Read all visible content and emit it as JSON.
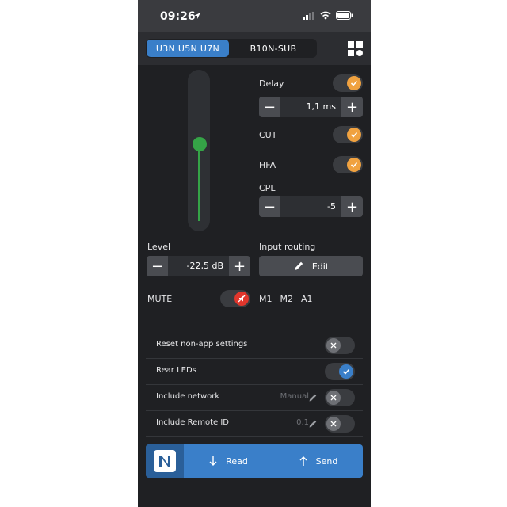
{
  "status": {
    "time": "09:26"
  },
  "header": {
    "tabs": [
      {
        "label": "U3N  U5N  U7N",
        "active": true
      },
      {
        "label": "B10N-SUB",
        "active": false
      }
    ],
    "menu_icon": "grid-icon"
  },
  "level": {
    "label": "Level",
    "value": "-22,5 dB",
    "slider_fraction": 0.45
  },
  "delay": {
    "label": "Delay",
    "value": "1,1 ms",
    "enabled": true
  },
  "cut": {
    "label": "CUT",
    "enabled": true
  },
  "hfa": {
    "label": "HFA",
    "enabled": true
  },
  "cpl": {
    "label": "CPL",
    "value": "-5"
  },
  "input_routing": {
    "label": "Input routing",
    "edit_label": "Edit",
    "options": [
      "M1",
      "M2",
      "A1"
    ]
  },
  "mute": {
    "label": "MUTE",
    "enabled": true
  },
  "settings": [
    {
      "label": "Reset non-app settings",
      "value": "",
      "enabled": false
    },
    {
      "label": "Rear LEDs",
      "value": "",
      "enabled": true
    },
    {
      "label": "Include network",
      "value": "Manual",
      "enabled": false
    },
    {
      "label": "Include Remote ID",
      "value": "0.1",
      "enabled": false
    }
  ],
  "actions": {
    "read_label": "Read",
    "send_label": "Send"
  },
  "colors": {
    "accent": "#3a7fc9",
    "toggle_on": "#f0a240",
    "mute": "#e0362c",
    "level": "#35a447"
  }
}
